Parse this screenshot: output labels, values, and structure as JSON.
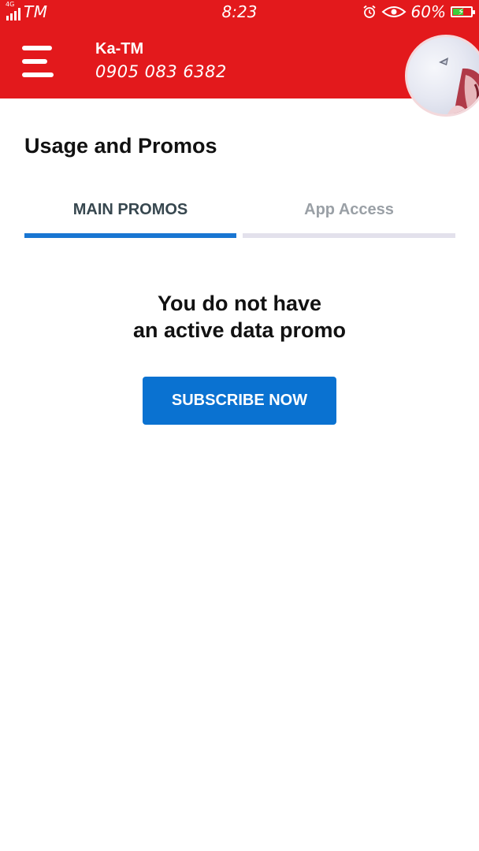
{
  "status_bar": {
    "network": "4G",
    "carrier": "TM",
    "time": "8:23",
    "battery": "60%",
    "battery_level": 0.6,
    "icons": [
      "signal-icon",
      "alarm-icon",
      "eye-icon",
      "battery-icon"
    ]
  },
  "header": {
    "account_name": "Ka-TM",
    "phone_number": "0905 083 6382",
    "menu_icon": "hamburger-menu-icon",
    "avatar": "profile-avatar"
  },
  "main": {
    "title": "Usage and Promos",
    "tabs": [
      {
        "label": "MAIN PROMOS",
        "active": true
      },
      {
        "label": "App Access",
        "active": false
      }
    ],
    "empty_line1": "You do not have",
    "empty_line2": "an active data promo",
    "subscribe_label": "SUBSCRIBE NOW"
  },
  "colors": {
    "brand_red": "#e3191c",
    "accent_blue": "#1976d2",
    "button_blue": "#0a72d1"
  }
}
